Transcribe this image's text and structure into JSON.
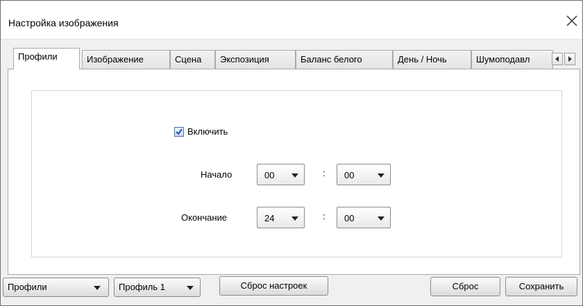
{
  "window": {
    "title": "Настройка изображения",
    "close_icon": "close-icon"
  },
  "tabs": [
    {
      "label": "Профили",
      "active": true
    },
    {
      "label": "Изображение",
      "active": false
    },
    {
      "label": "Сцена",
      "active": false
    },
    {
      "label": "Экспозиция",
      "active": false
    },
    {
      "label": "Баланс белого",
      "active": false
    },
    {
      "label": "День / Ночь",
      "active": false
    },
    {
      "label": "Шумоподавл",
      "active": false
    }
  ],
  "tab_scroll": {
    "left_icon": "arrow-left-icon",
    "right_icon": "arrow-right-icon"
  },
  "profile": {
    "enable_label": "Включить",
    "enable_checked": true,
    "start_label": "Начало",
    "start_hour": "00",
    "start_minute": "00",
    "end_label": "Окончание",
    "end_hour": "24",
    "end_minute": "00",
    "separator": ":"
  },
  "footer": {
    "profiles_dropdown": "Профили",
    "profile_dropdown": "Профиль 1",
    "reset_settings_label": "Сброс настроек",
    "reset_label": "Сброс",
    "save_label": "Сохранить"
  },
  "colors": {
    "check": "#1f4e9e",
    "panel_bg": "#ffffff",
    "dialog_bg": "#f0f0f0"
  }
}
